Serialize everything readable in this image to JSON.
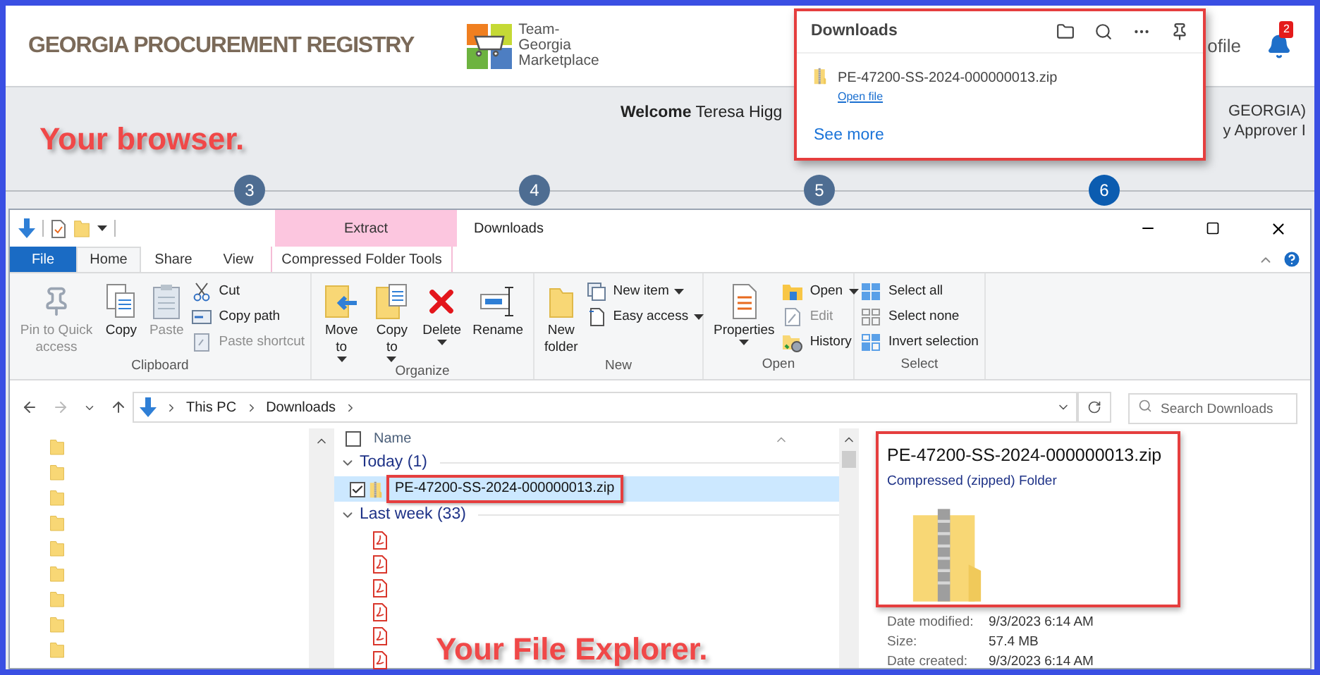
{
  "browser": {
    "brand": "GEORGIA PROCUREMENT REGISTRY",
    "logo_lines": [
      "Team-",
      "Georgia",
      "Marketplace"
    ],
    "profile_link": "ofile",
    "notification_badge": "2",
    "welcome_label": "Welcome",
    "user_name": "Teresa Higg",
    "org": "GEORGIA)",
    "role": "y Approver I",
    "note": "Your browser.",
    "steps": [
      {
        "label": "3",
        "selected": false
      },
      {
        "label": "4",
        "selected": false
      },
      {
        "label": "5",
        "selected": false
      },
      {
        "label": "6",
        "selected": true
      }
    ]
  },
  "downloads_panel": {
    "title": "Downloads",
    "items": [
      {
        "name": "PE-47200-SS-2024-000000013.zip",
        "action": "Open file"
      }
    ],
    "see_more": "See more"
  },
  "explorer": {
    "title": "Downloads",
    "contextual_header": "Extract",
    "tabs": [
      {
        "label": "File",
        "kind": "menu",
        "selected": false
      },
      {
        "label": "Home",
        "kind": "tab",
        "selected": true
      },
      {
        "label": "Share",
        "kind": "tab",
        "selected": false
      },
      {
        "label": "View",
        "kind": "tab",
        "selected": false
      },
      {
        "label": "Compressed Folder Tools",
        "kind": "contextual",
        "selected": false
      }
    ],
    "ribbon": [
      {
        "label": "Clipboard",
        "commands": [
          {
            "label": "Pin to Quick access",
            "kind": "large",
            "disabled": true,
            "dropdown": false
          },
          {
            "label": "Copy",
            "kind": "large",
            "disabled": false,
            "dropdown": false
          },
          {
            "label": "Paste",
            "kind": "large",
            "disabled": true,
            "dropdown": false
          },
          {
            "label": "Cut",
            "kind": "small",
            "disabled": false,
            "dropdown": false
          },
          {
            "label": "Copy path",
            "kind": "small",
            "disabled": false,
            "dropdown": false
          },
          {
            "label": "Paste shortcut",
            "kind": "small",
            "disabled": true,
            "dropdown": false
          }
        ]
      },
      {
        "label": "Organize",
        "commands": [
          {
            "label": "Move to",
            "kind": "large",
            "disabled": false,
            "dropdown": true
          },
          {
            "label": "Copy to",
            "kind": "large",
            "disabled": false,
            "dropdown": true
          },
          {
            "label": "Delete",
            "kind": "large",
            "disabled": false,
            "dropdown": true
          },
          {
            "label": "Rename",
            "kind": "large",
            "disabled": false,
            "dropdown": false
          }
        ]
      },
      {
        "label": "New",
        "commands": [
          {
            "label": "New folder",
            "kind": "large",
            "disabled": false,
            "dropdown": false
          },
          {
            "label": "New item",
            "kind": "small",
            "disabled": false,
            "dropdown": true
          },
          {
            "label": "Easy access",
            "kind": "small",
            "disabled": false,
            "dropdown": true
          }
        ]
      },
      {
        "label": "Open",
        "commands": [
          {
            "label": "Properties",
            "kind": "large",
            "disabled": false,
            "dropdown": true
          },
          {
            "label": "Open",
            "kind": "small",
            "disabled": false,
            "dropdown": true
          },
          {
            "label": "Edit",
            "kind": "small",
            "disabled": true,
            "dropdown": false
          },
          {
            "label": "History",
            "kind": "small",
            "disabled": false,
            "dropdown": false
          }
        ]
      },
      {
        "label": "Select",
        "commands": [
          {
            "label": "Select all",
            "kind": "small",
            "disabled": false,
            "dropdown": false
          },
          {
            "label": "Select none",
            "kind": "small",
            "disabled": false,
            "dropdown": false
          },
          {
            "label": "Invert selection",
            "kind": "small",
            "disabled": false,
            "dropdown": false
          }
        ]
      }
    ],
    "path": [
      "This PC",
      "Downloads"
    ],
    "search": {
      "placeholder": "Search Downloads"
    },
    "nav_folders": [
      {
        "kind": "folder"
      },
      {
        "kind": "folder"
      },
      {
        "kind": "folder"
      },
      {
        "kind": "folder"
      },
      {
        "kind": "folder"
      },
      {
        "kind": "folder"
      },
      {
        "kind": "folder"
      },
      {
        "kind": "folder"
      },
      {
        "kind": "folder"
      }
    ],
    "file_list": {
      "column": "Name",
      "header_checked": false,
      "groups": [
        {
          "label": "Today (1)",
          "expanded": true,
          "files": [
            {
              "kind": "zip",
              "name": "PE-47200-SS-2024-000000013.zip",
              "checked": true,
              "selected": true
            }
          ]
        },
        {
          "label": "Last week (33)",
          "expanded": true,
          "files": [
            {
              "kind": "pdf"
            },
            {
              "kind": "pdf"
            },
            {
              "kind": "pdf"
            },
            {
              "kind": "pdf"
            },
            {
              "kind": "pdf"
            },
            {
              "kind": "pdf"
            }
          ]
        }
      ]
    },
    "note": "Your File Explorer.",
    "preview": {
      "title": "PE-47200-SS-2024-000000013.zip",
      "type": "Compressed (zipped) Folder",
      "details": [
        {
          "label": "Date modified:",
          "value": "9/3/2023 6:14 AM"
        },
        {
          "label": "Size:",
          "value": "57.4 MB"
        },
        {
          "label": "Date created:",
          "value": "9/3/2023 6:14 AM"
        }
      ]
    }
  }
}
